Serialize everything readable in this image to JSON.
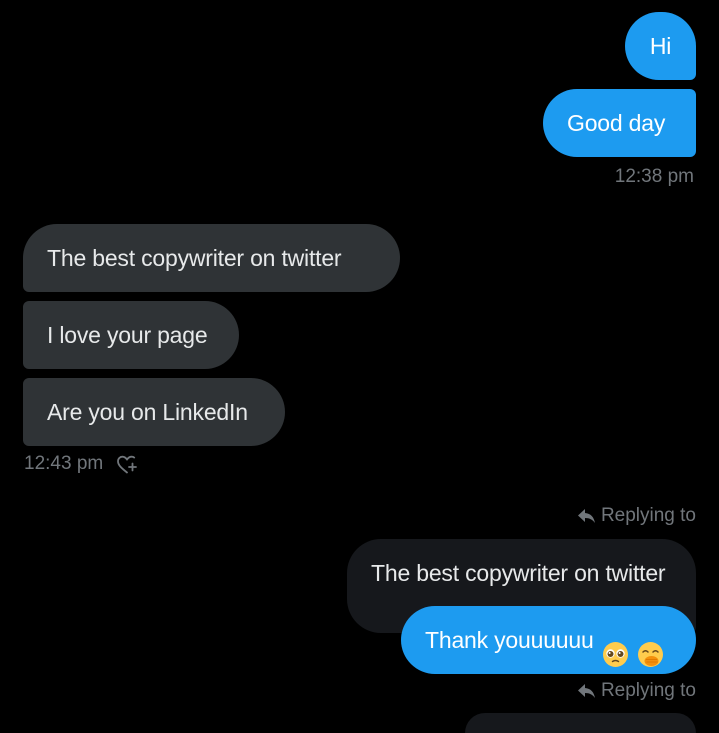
{
  "colors": {
    "background": "#000000",
    "outgoing_bubble": "#1d9bf0",
    "incoming_bubble": "#2f3336",
    "quoted_bubble": "#16181c",
    "timestamp": "#71767b"
  },
  "messages": {
    "out_1": "Hi",
    "out_2": "Good day",
    "out_time": "12:38 pm",
    "in_1": "The best copywriter on twitter",
    "in_2": "I love your page",
    "in_3": "Are you on LinkedIn",
    "in_time": "12:43 pm",
    "in_react_icon": "heart-plus-icon"
  },
  "reply_1": {
    "replying_label": "Replying to",
    "replying_icon": "reply-arrow-icon",
    "quoted_text": "The best copywriter on twitter",
    "reply_text": "Thank youuuuuu",
    "reply_emojis": [
      "pleading-face-emoji",
      "face-with-hand-over-mouth-emoji"
    ]
  },
  "reply_2": {
    "replying_label": "Replying to",
    "replying_icon": "reply-arrow-icon"
  }
}
